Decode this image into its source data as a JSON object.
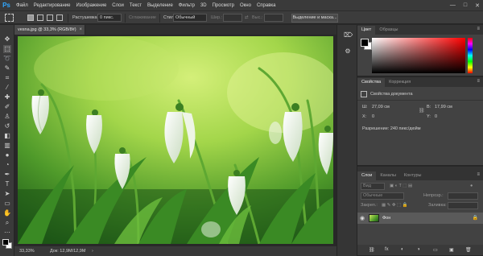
{
  "app": {
    "logo": "Ps"
  },
  "menu": [
    "Файл",
    "Редактирование",
    "Изображение",
    "Слои",
    "Текст",
    "Выделение",
    "Фильтр",
    "3D",
    "Просмотр",
    "Окно",
    "Справка"
  ],
  "window_controls": {
    "minimize": "—",
    "maximize": "□",
    "close": "✕"
  },
  "options": {
    "feather_label": "Растушевка:",
    "feather_value": "0 пикс.",
    "antialias_label": "Сглаживание",
    "style_label": "Стиль:",
    "style_value": "Обычный",
    "width_label": "Шир.:",
    "height_label": "Выс.:",
    "select_mask_button": "Выделение и маска..."
  },
  "document": {
    "tab_title": "vesna.jpg @ 33,3% (RGB/8#)",
    "tab_close": "×"
  },
  "status": {
    "zoom": "33,33%",
    "doc_info": "Док: 12,9M/12,9M",
    "arrow": "›"
  },
  "color_panel": {
    "tabs": [
      "Цвет",
      "Образцы"
    ],
    "active_tab": 0,
    "menu": "≡"
  },
  "properties_panel": {
    "tabs": [
      "Свойства",
      "Коррекция"
    ],
    "active_tab": 0,
    "menu": "≡",
    "header": "Свойства документа",
    "width_label": "Ш:",
    "width_value": "27,09 см",
    "height_label": "В:",
    "height_value": "17,99 см",
    "x_label": "X:",
    "x_value": "0",
    "y_label": "Y:",
    "y_value": "0",
    "resolution": "Разрешение: 240 пикс/дюйм"
  },
  "layers_panel": {
    "tabs": [
      "Слои",
      "Каналы",
      "Контуры"
    ],
    "active_tab": 0,
    "menu": "≡",
    "kind_filter": "Вид",
    "blend_mode": "Обычные",
    "opacity_label": "Непрозр.:",
    "lock_label": "Закреп.:",
    "fill_label": "Заливка:",
    "layer_name": "Фон",
    "bottom_icons": [
      "⛓",
      "fx",
      "◐",
      "◑",
      "▭",
      "▣",
      "🗑"
    ]
  },
  "colors": {
    "accent": "#31a8ff",
    "picker_hue": "#ff0000",
    "layer_selected": "#5a5a5a"
  }
}
